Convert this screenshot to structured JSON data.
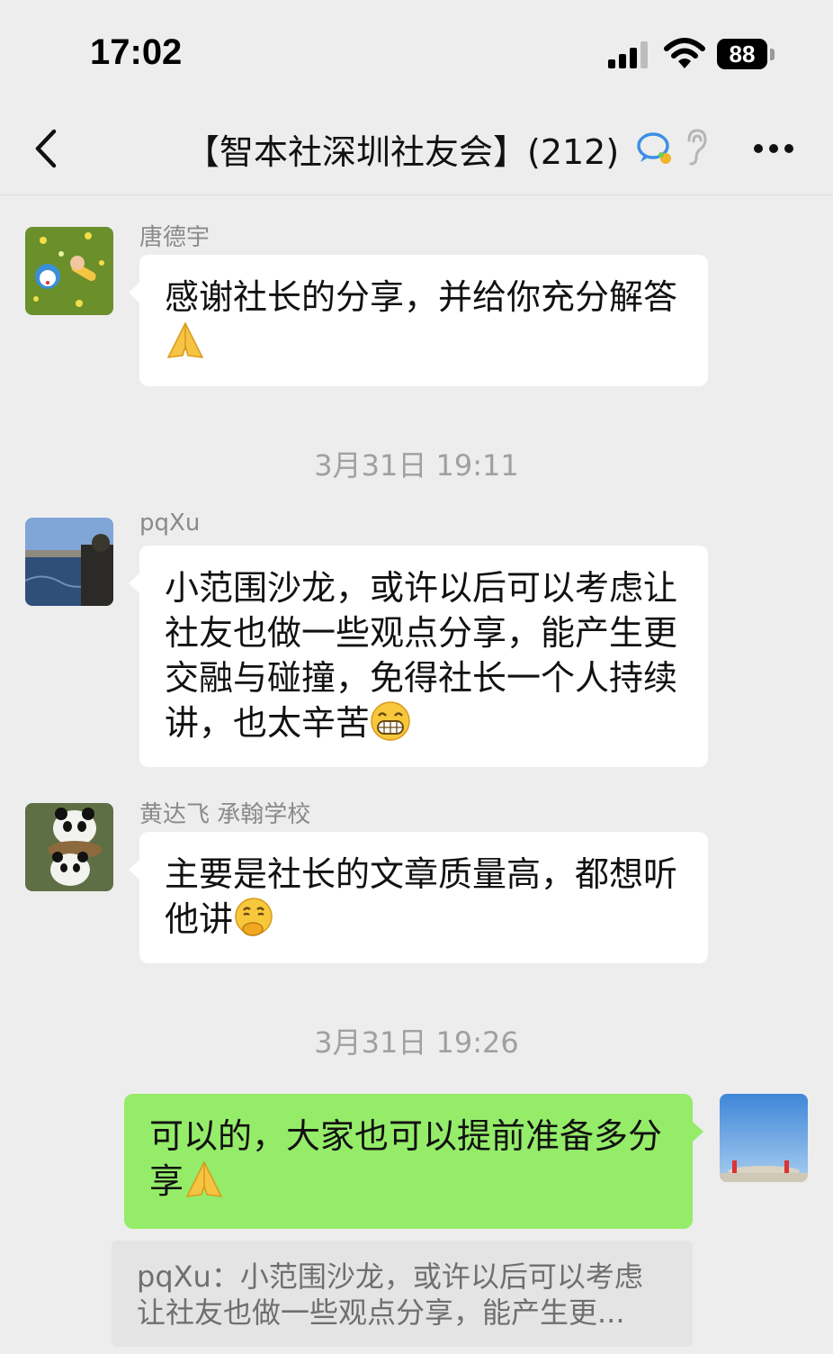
{
  "status_bar": {
    "time": "17:02",
    "battery": "88"
  },
  "header": {
    "title": "【智本社深圳社友会】(212)"
  },
  "messages": [
    {
      "sender": "唐德宇",
      "text": "感谢社长的分享，并给你充分解答",
      "emoji": "folded-hands-emoji"
    },
    {
      "timestamp": "3月31日 19:11"
    },
    {
      "sender": "pqXu",
      "text": "小范围沙龙，或许以后可以考虑让社友也做一些观点分享，能产生更交融与碰撞，免得社长一个人持续讲，也太辛苦",
      "emoji": "grinning-emoji"
    },
    {
      "sender": "黄达飞 承翰学校",
      "text": "主要是社长的文章质量高，都想听他讲",
      "emoji": "thinking-face-emoji"
    },
    {
      "timestamp": "3月31日 19:26"
    },
    {
      "sender": "me",
      "text": "可以的，大家也可以提前准备多分享",
      "emoji": "folded-hands-emoji",
      "quote": "pqXu：小范围沙龙，或许以后可以考虑让社友也做一些观点分享，能产生更..."
    }
  ],
  "colors": {
    "own_bubble": "#95ec69",
    "background": "#ededed",
    "bubble": "#ffffff"
  }
}
